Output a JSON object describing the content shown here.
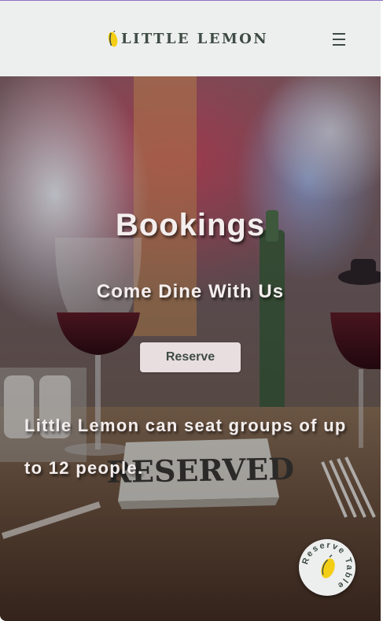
{
  "header": {
    "logo_text": "LITTLE LEMON",
    "menu_icon": "hamburger-menu-icon"
  },
  "hero": {
    "title": "Bookings",
    "subtitle": "Come Dine With Us",
    "reserve_label": "Reserve",
    "description": "Little Lemon can seat groups of up to 12 people.",
    "sign_text": "RESERVED"
  },
  "badge": {
    "text": "Reserve Table"
  },
  "colors": {
    "navbar_bg": "#edefee",
    "brand_green": "#3f4c45",
    "lemon_yellow": "#f4ce14",
    "button_bg": "#e8dedf",
    "hero_text": "#f4eeee"
  }
}
